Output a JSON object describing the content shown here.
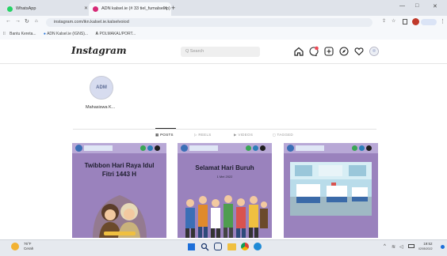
{
  "browser": {
    "tabs": [
      {
        "title": "WhatsApp",
        "favicon_color": "#25d366"
      },
      {
        "title": "ADN kalsel.ie (# 33 tiel_fumalsel.ip)",
        "favicon_color": "#d62976"
      }
    ],
    "new_tab_symbol": "+",
    "window_controls": [
      "—",
      "□",
      "✕"
    ],
    "url": "instagram.com/ikn.kalsel.ie.kalselvoiod",
    "bookmarks": [
      "Bantu Kereta...",
      "ADN Kalsel.ie (IGNS)...",
      "POLMAKAL/PORT..."
    ]
  },
  "instagram": {
    "logo": "Instagram",
    "search_placeholder": "Q Search",
    "nav_icons": [
      "home-icon",
      "messenger-icon",
      "new-post-icon",
      "explore-icon",
      "heart-icon",
      "profile-icon"
    ],
    "profile": {
      "avatar_text": "ADM",
      "name": "Mahasiswa K..."
    },
    "tabs": [
      "POSTS",
      "REELS",
      "VIDEOS",
      "TAGGED"
    ],
    "active_tab": "POSTS",
    "posts": [
      {
        "title": "Twibbon Hari Raya Idul Fitri 1443 H",
        "subtitle": "",
        "kind": "eid"
      },
      {
        "title": "Selamat Hari Buruh",
        "subtitle": "1 Mei 2022",
        "kind": "labour"
      },
      {
        "title": "",
        "subtitle": "",
        "kind": "hospital"
      }
    ]
  },
  "taskbar": {
    "weather_temp": "76°F",
    "weather_desc": "Cerah",
    "time": "19:52",
    "date": "02/05/2022"
  },
  "colors": {
    "post_bg": "#9a82bd",
    "ig_accent": "#ed4956"
  }
}
